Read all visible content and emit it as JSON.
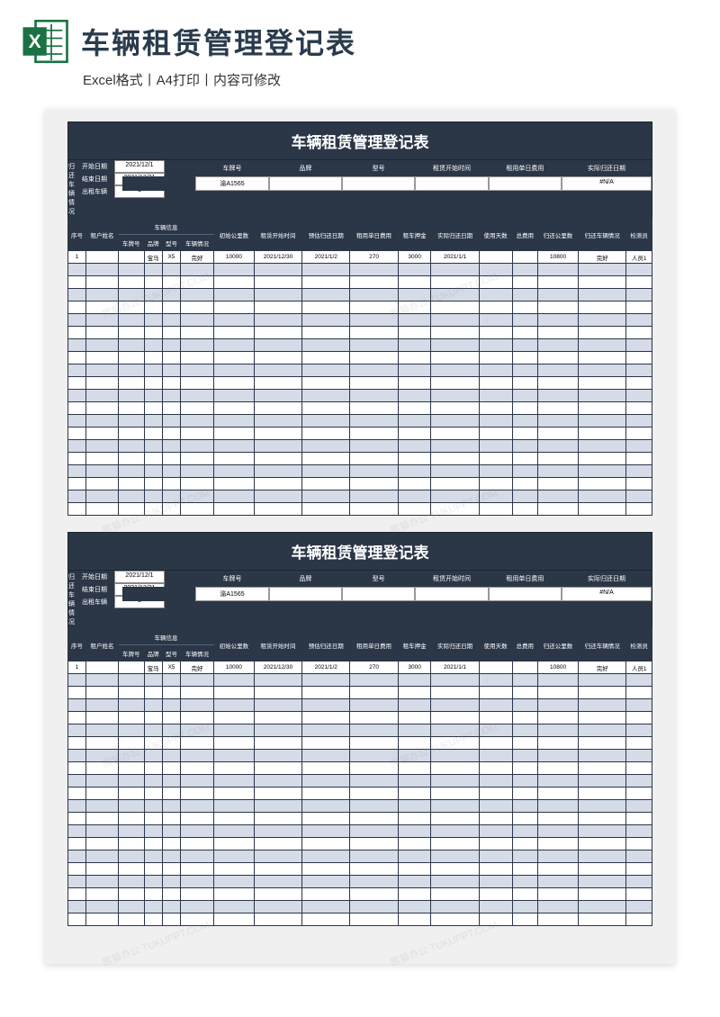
{
  "header": {
    "title": "车辆租赁管理登记表",
    "subtitle": "Excel格式丨A4打印丨内容可修改"
  },
  "sheet": {
    "title": "车辆租赁管理登记表",
    "summary_labels": [
      "车牌号",
      "品牌",
      "型号",
      "租赁开始时间",
      "租用单日费用",
      "实际归还日期",
      "归还车辆情况"
    ],
    "summary_values": [
      "渝A1565",
      "",
      "",
      "",
      "",
      "#N/A",
      ""
    ],
    "date_labels": [
      "开始日期",
      "结束日期",
      "出租车辆"
    ],
    "date_values": [
      "2021/12/1",
      "2021/12/31",
      "1"
    ],
    "columns_row1": [
      "序号",
      "租户姓名",
      "车辆信息",
      "",
      "",
      "",
      "初始公里数",
      "租赁开始时间",
      "预估归还日期",
      "租用单日费用",
      "租车押金",
      "实际归还日期",
      "使用天数",
      "总费用",
      "归还公里数",
      "归还车辆情况",
      "检测员"
    ],
    "columns_row2_vehicle": [
      "车牌号",
      "品牌",
      "型号",
      "车辆情况"
    ],
    "data_row": [
      "1",
      "",
      "",
      "宝马",
      "X5",
      "完好",
      "10000",
      "2021/12/30",
      "2021/1/2",
      "270",
      "3000",
      "2021/1/1",
      "",
      "",
      "10800",
      "完好",
      "人员1"
    ]
  },
  "watermark": "熊猫办公 TUKUPPT.COM"
}
